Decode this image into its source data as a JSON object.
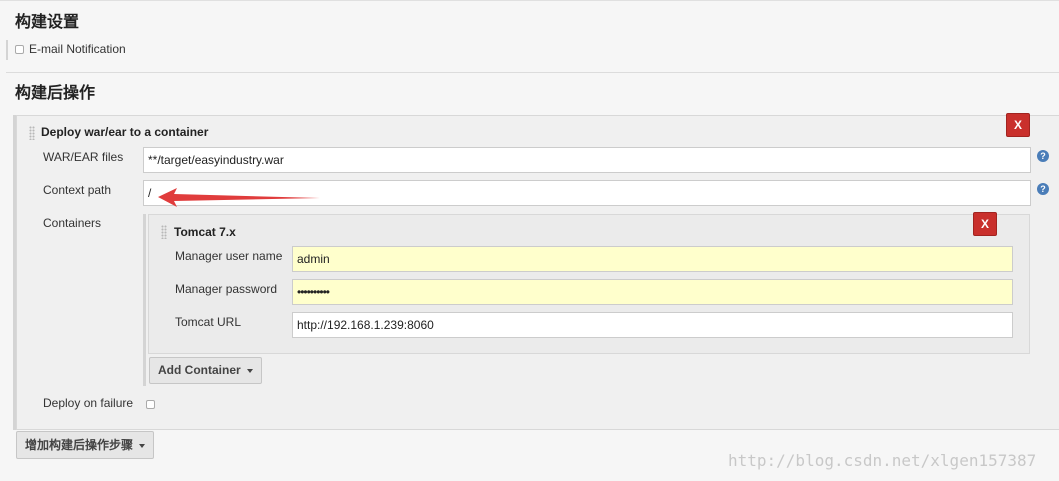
{
  "build_settings": {
    "title": "构建设置",
    "email_notification_label": "E-mail Notification"
  },
  "post_build": {
    "title": "构建后操作",
    "deploy_panel": {
      "title": "Deploy war/ear to a container",
      "delete_label": "X",
      "war_ear_files": {
        "label": "WAR/EAR files",
        "value": "**/target/easyindustry.war"
      },
      "context_path": {
        "label": "Context path",
        "value": "/"
      },
      "containers": {
        "label": "Containers",
        "tomcat": {
          "title": "Tomcat 7.x",
          "delete_label": "X",
          "manager_user": {
            "label": "Manager user name",
            "value": "admin"
          },
          "manager_password": {
            "label": "Manager password",
            "value": "••••••••••"
          },
          "tomcat_url": {
            "label": "Tomcat URL",
            "value": "http://192.168.1.239:8060"
          }
        },
        "add_container_label": "Add Container"
      },
      "deploy_on_failure_label": "Deploy on failure"
    },
    "add_step_label": "增加构建后操作步骤"
  },
  "help_icon_glyph": "?",
  "watermark": "http://blog.csdn.net/xlgen157387",
  "colors": {
    "delete_red": "#c9302c",
    "field_yellow": "#ffffcc",
    "help_blue": "#4a7db8",
    "arrow_red": "#e03c3c"
  }
}
